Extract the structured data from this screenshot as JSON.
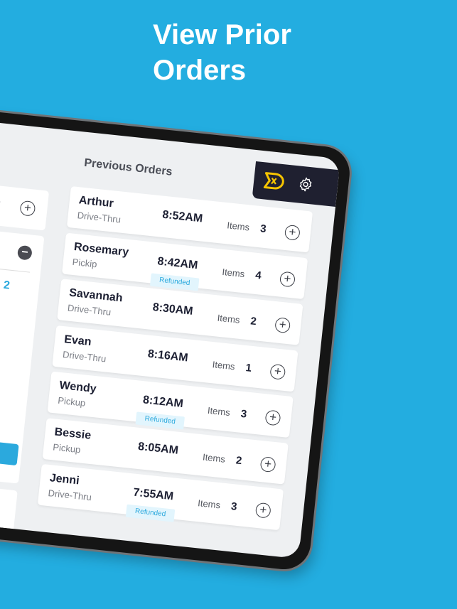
{
  "headline": {
    "line1": "View Prior Orders"
  },
  "left_panel": {
    "qty_top": "2",
    "qty_blue": "2"
  },
  "previous_orders": {
    "title": "Previous Orders",
    "items_label": "Items",
    "orders": [
      {
        "name": "Arthur",
        "type": "Drive-Thru",
        "time": "8:52AM",
        "items": "3",
        "badge": null
      },
      {
        "name": "Rosemary",
        "type": "Pickip",
        "time": "8:42AM",
        "items": "4",
        "badge": "Refunded"
      },
      {
        "name": "Savannah",
        "type": "Drive-Thru",
        "time": "8:30AM",
        "items": "2",
        "badge": null
      },
      {
        "name": "Evan",
        "type": "Drive-Thru",
        "time": "8:16AM",
        "items": "1",
        "badge": null
      },
      {
        "name": "Wendy",
        "type": "Pickup",
        "time": "8:12AM",
        "items": "3",
        "badge": "Refunded"
      },
      {
        "name": "Bessie",
        "type": "Pickup",
        "time": "8:05AM",
        "items": "2",
        "badge": null
      },
      {
        "name": "Jenni",
        "type": "Drive-Thru",
        "time": "7:55AM",
        "items": "3",
        "badge": "Refunded"
      }
    ]
  },
  "icons": {
    "logo": "dx-logo",
    "settings": "gear-icon"
  },
  "colors": {
    "background": "#23ade0",
    "accent": "#2ba9dd",
    "logo": "#f5c400",
    "header_dark": "#1f2030"
  }
}
